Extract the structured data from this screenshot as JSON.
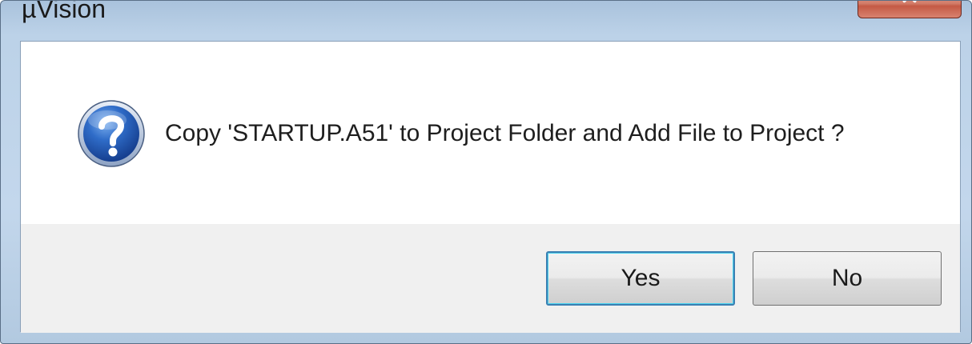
{
  "window": {
    "title": "µVision"
  },
  "dialog": {
    "icon": "question-icon",
    "message": "Copy 'STARTUP.A51' to Project Folder and Add File to Project ?"
  },
  "buttons": {
    "yes_label": "Yes",
    "no_label": "No"
  },
  "colors": {
    "close_button": "#c45a45",
    "icon_blue": "#1f4fa8",
    "default_button_border": "#3c7fb1"
  }
}
